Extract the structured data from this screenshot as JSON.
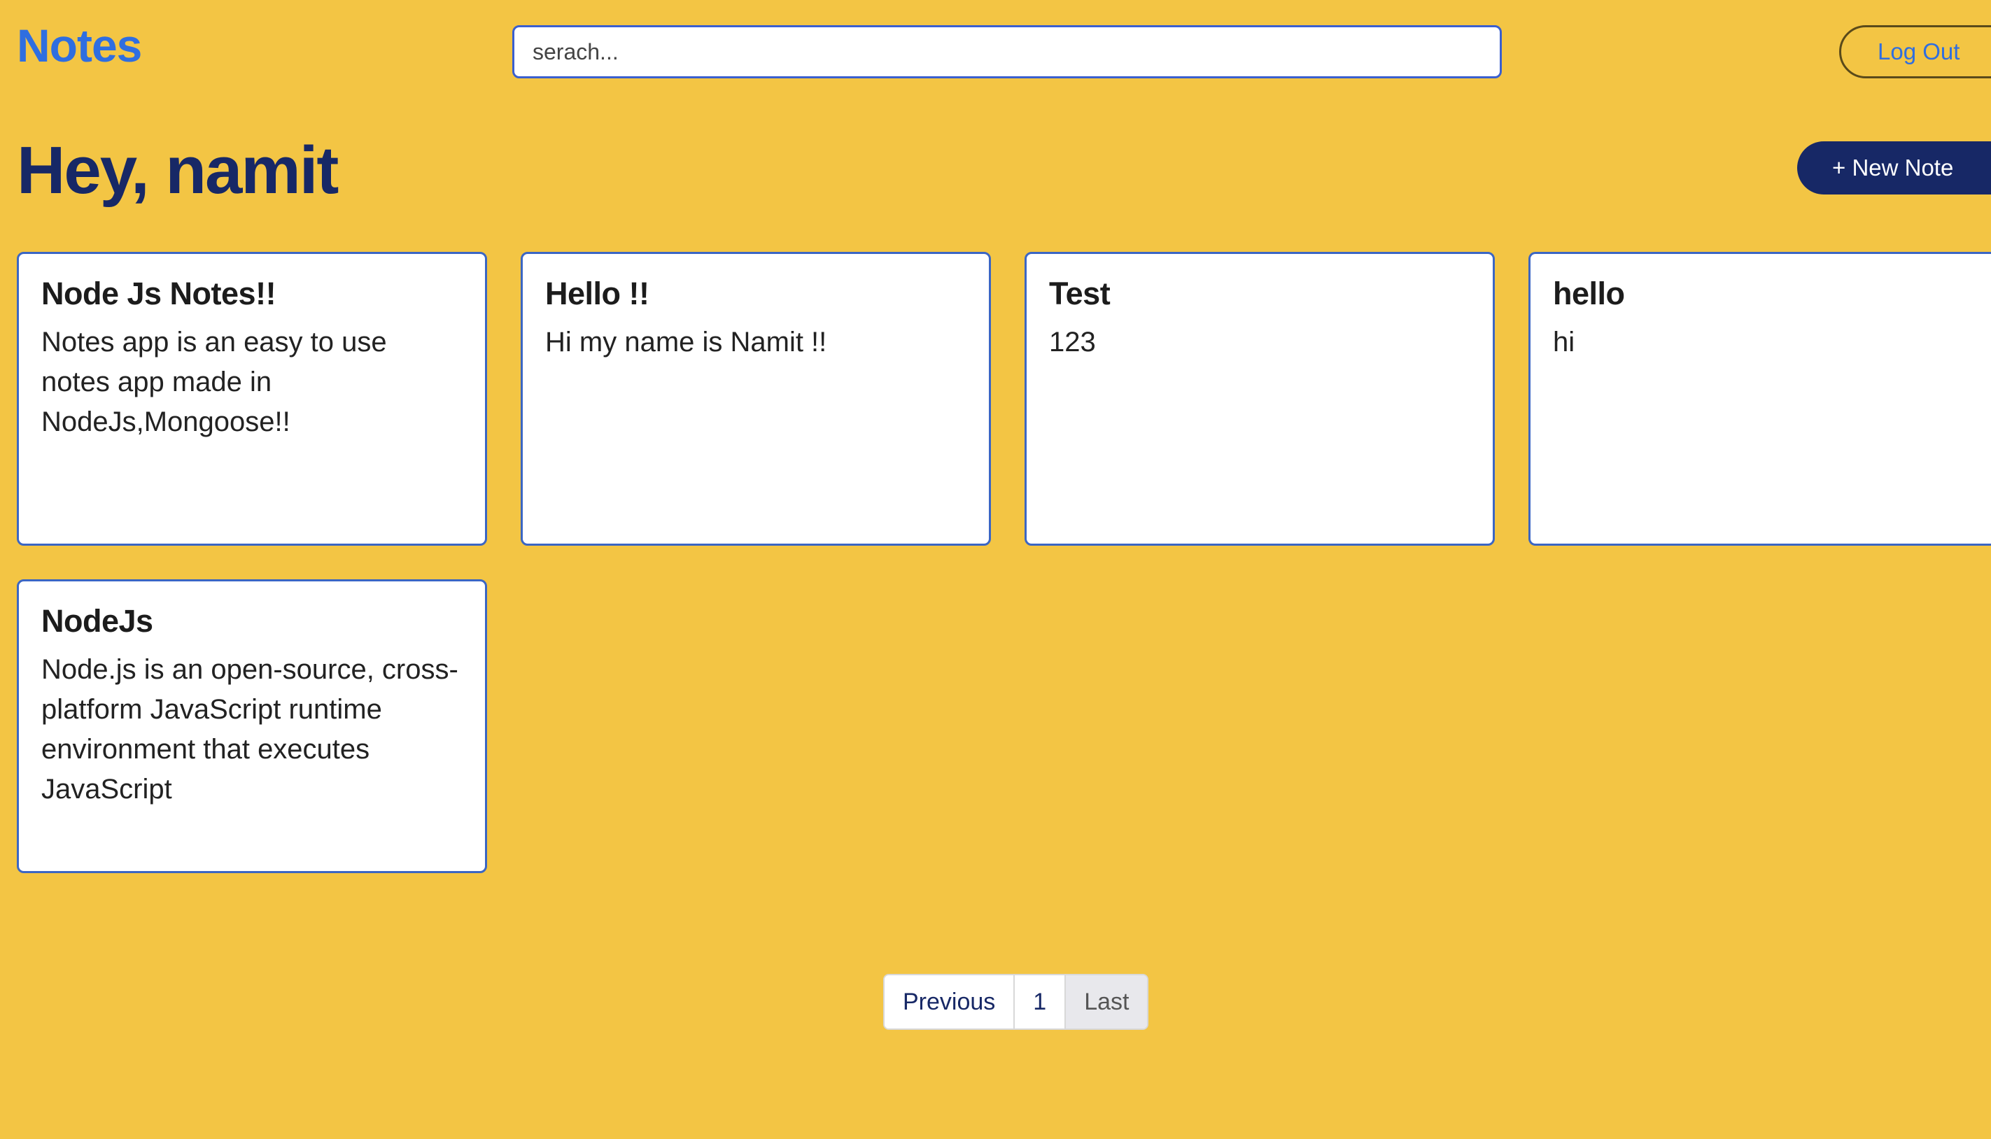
{
  "header": {
    "brand": "Notes",
    "search_placeholder": "serach...",
    "logout_label": "Log Out"
  },
  "main": {
    "greeting": "Hey, namit",
    "new_note_label": "+ New Note"
  },
  "notes": [
    {
      "title": "Node Js Notes!!",
      "body": "Notes app is an easy to use notes app made in NodeJs,Mongoose!!"
    },
    {
      "title": "Hello !!",
      "body": "Hi my name is Namit !!"
    },
    {
      "title": "Test",
      "body": "123"
    },
    {
      "title": "hello",
      "body": "hi"
    },
    {
      "title": "NodeJs",
      "body": "Node.js is an open-source, cross-platform JavaScript runtime environment that executes JavaScript"
    }
  ],
  "pagination": {
    "previous_label": "Previous",
    "page_label": "1",
    "last_label": "Last"
  },
  "colors": {
    "background": "#f3c544",
    "brand": "#2f6ee0",
    "navy": "#172866"
  }
}
